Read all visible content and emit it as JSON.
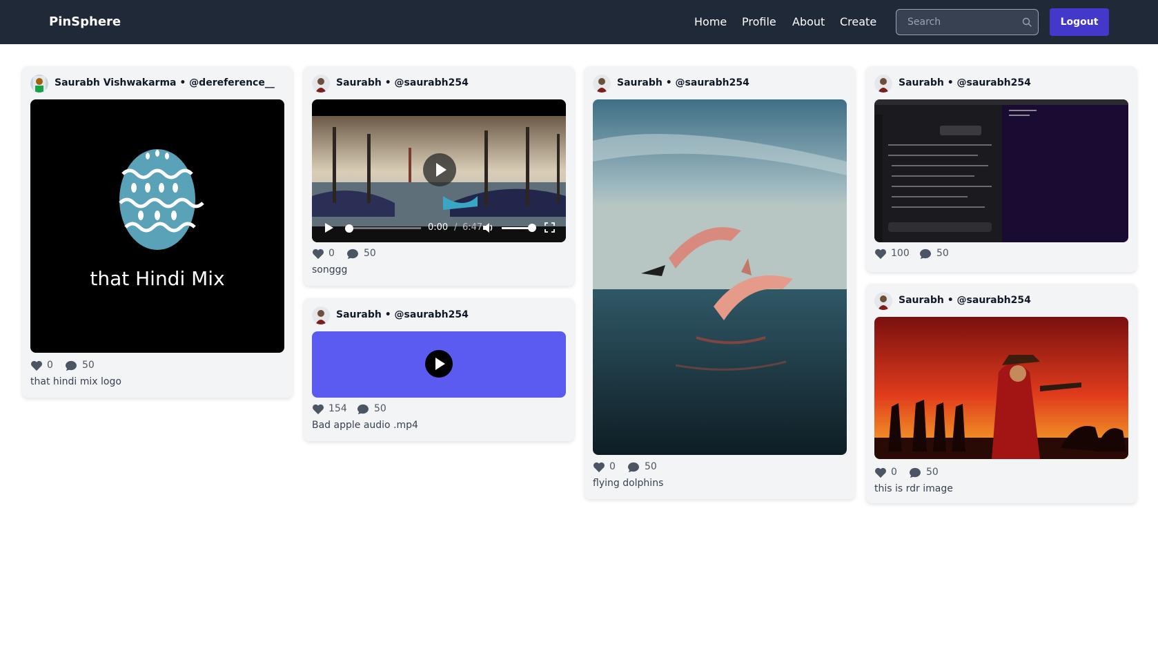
{
  "app": {
    "brand": "PinSphere"
  },
  "nav": {
    "home": "Home",
    "profile": "Profile",
    "about": "About",
    "create": "Create",
    "logout": "Logout"
  },
  "search": {
    "placeholder": "Search",
    "value": ""
  },
  "icons": {
    "search": "search-icon",
    "like": "heart-icon",
    "comment": "comment-icon",
    "play": "play-icon",
    "volume": "volume-icon",
    "fullscreen": "fullscreen-icon"
  },
  "colors": {
    "navbar": "#1f2937",
    "logout": "#4338ca",
    "audio_block": "#5b5bf2",
    "card": "#f3f4f6"
  },
  "posts": [
    {
      "author": "Saurabh Vishwakarma • @dereference__",
      "likes": "0",
      "comments": "50",
      "caption": "that hindi mix logo",
      "media_text": "that Hindi Mix"
    },
    {
      "author": "Saurabh • @saurabh254",
      "likes": "0",
      "comments": "50",
      "caption": "songgg",
      "video": {
        "current": "0:00",
        "separator": "/",
        "duration": "6:47"
      }
    },
    {
      "author": "Saurabh • @saurabh254",
      "likes": "154",
      "comments": "50",
      "caption": "Bad apple audio .mp4"
    },
    {
      "author": "Saurabh • @saurabh254",
      "likes": "0",
      "comments": "50",
      "caption": "flying dolphins"
    },
    {
      "author": "Saurabh • @saurabh254",
      "likes": "100",
      "comments": "50",
      "caption": ""
    },
    {
      "author": "Saurabh • @saurabh254",
      "likes": "0",
      "comments": "50",
      "caption": "this is rdr image"
    }
  ]
}
